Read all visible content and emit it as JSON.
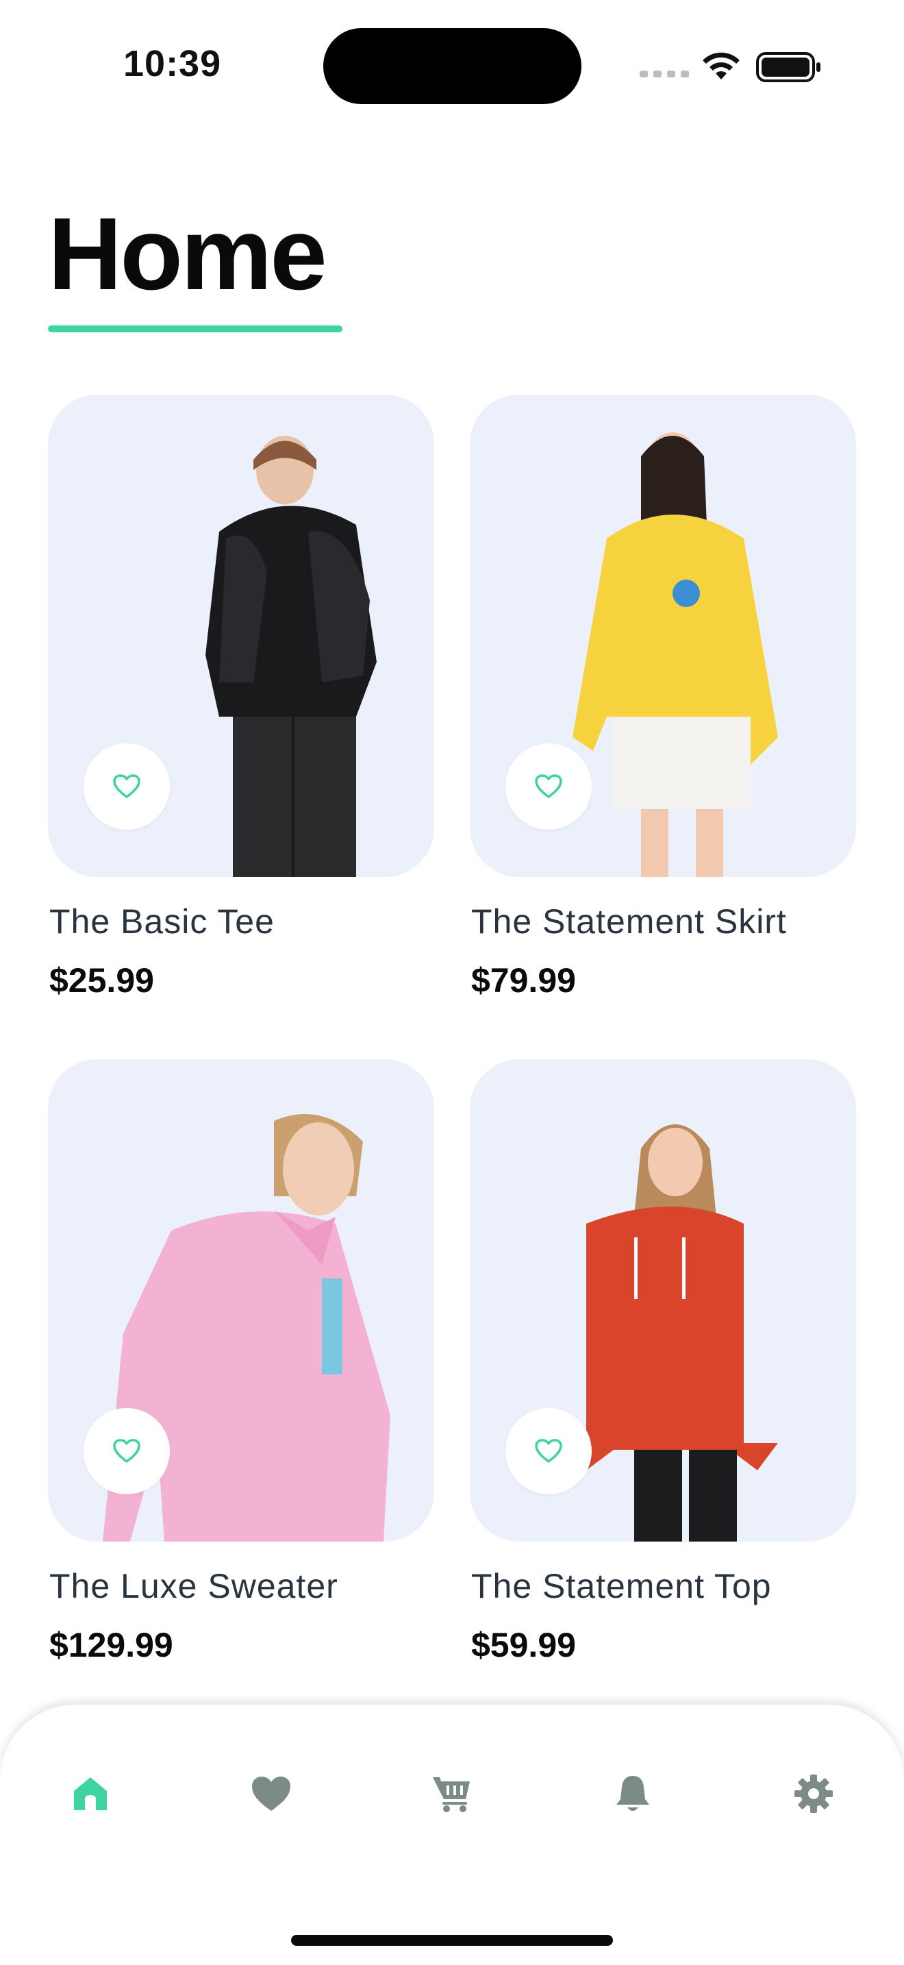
{
  "status_bar": {
    "time": "10:39"
  },
  "header": {
    "title": "Home"
  },
  "colors": {
    "accent": "#3ed3a0",
    "card_bg": "#ebf0fa",
    "nav_inactive": "#7c8b88"
  },
  "products": [
    {
      "name": "The Basic Tee",
      "price": "$25.99",
      "outfit": "black puffer jacket"
    },
    {
      "name": "The Statement Skirt",
      "price": "$79.99",
      "outfit": "yellow hoodie"
    },
    {
      "name": "The Luxe Sweater",
      "price": "$129.99",
      "outfit": "pink hoodie"
    },
    {
      "name": "The Statement Top",
      "price": "$59.99",
      "outfit": "red hoodie"
    }
  ],
  "nav": [
    {
      "icon": "home-icon",
      "active": true
    },
    {
      "icon": "heart-icon",
      "active": false
    },
    {
      "icon": "cart-icon",
      "active": false
    },
    {
      "icon": "bell-icon",
      "active": false
    },
    {
      "icon": "gear-icon",
      "active": false
    }
  ]
}
